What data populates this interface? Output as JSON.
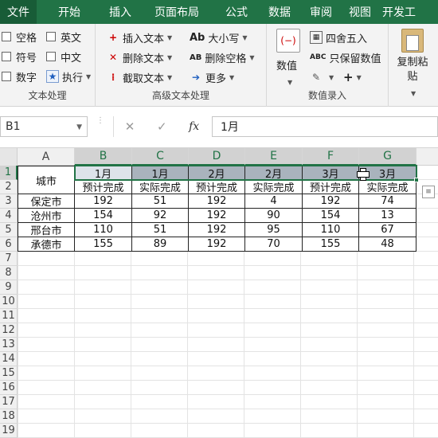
{
  "ribbon_tabs": [
    "文件",
    "开始",
    "插入",
    "页面布局",
    "公式",
    "数据",
    "审阅",
    "视图",
    "开发工"
  ],
  "text_processing": {
    "checkboxes": [
      "空格",
      "符号",
      "数字",
      "英文",
      "中文"
    ],
    "execute_label": "执行",
    "group_label": "文本处理"
  },
  "advanced_text": {
    "insert_text": "插入文本",
    "delete_text": "删除文本",
    "extract_text": "截取文本",
    "case_prefix": "Ab",
    "case_label": "大小写",
    "remove_space_prefix": "AB",
    "remove_space_label": "删除空格",
    "more_label": "更多",
    "group_label": "高级文本处理"
  },
  "numeric_entry": {
    "value_label": "数值",
    "round_label": "四舍五入",
    "keep_value_prefix": "ABC",
    "keep_value_label": "只保留数值",
    "group_label": "数值录入",
    "copy_paste_label": "复制粘贴",
    "plus_symbol": "+"
  },
  "formula_bar": {
    "name_box": "B1",
    "cancel_symbol": "✕",
    "confirm_symbol": "✓",
    "fx_symbol": "fx",
    "content": "1月"
  },
  "columns": [
    "A",
    "B",
    "C",
    "D",
    "E",
    "F",
    "G"
  ],
  "rows": [
    "1",
    "2",
    "3",
    "4",
    "5",
    "6",
    "7",
    "8",
    "9",
    "10",
    "11",
    "12",
    "13",
    "14",
    "15",
    "16",
    "17",
    "18",
    "19"
  ],
  "table": {
    "city_header": "城市",
    "month_headers": [
      "1月",
      "1月",
      "2月",
      "2月",
      "3月",
      "3月"
    ],
    "sub_headers": [
      "预计完成",
      "实际完成",
      "预计完成",
      "实际完成",
      "预计完成",
      "实际完成"
    ],
    "data_rows": [
      {
        "city": "保定市",
        "values": [
          "192",
          "51",
          "192",
          "4",
          "192",
          "74"
        ]
      },
      {
        "city": "沧州市",
        "values": [
          "154",
          "92",
          "192",
          "90",
          "154",
          "13"
        ]
      },
      {
        "city": "邢台市",
        "values": [
          "110",
          "51",
          "192",
          "95",
          "110",
          "67"
        ]
      },
      {
        "city": "承德市",
        "values": [
          "155",
          "89",
          "192",
          "70",
          "155",
          "48"
        ]
      }
    ]
  },
  "colors": {
    "brand_green": "#217346",
    "selected_header_fill": "#a9b3bd"
  }
}
